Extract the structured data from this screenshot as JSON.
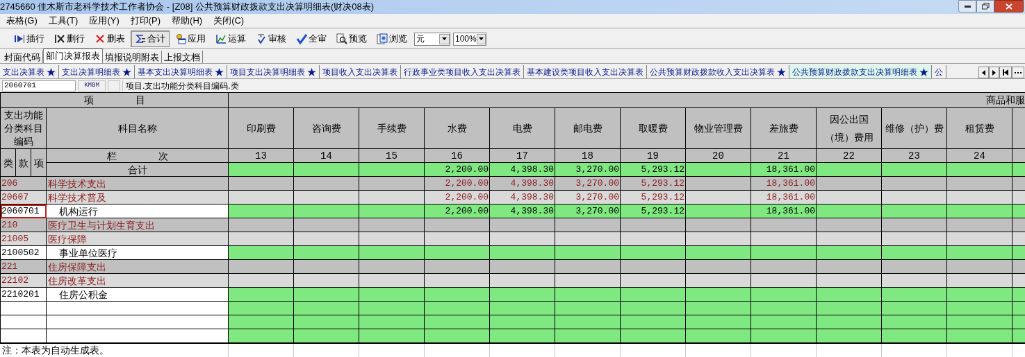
{
  "window": {
    "title": "2745660  佳木斯市老科学技术工作者协会 - [Z08] 公共预算财政拨款支出决算明细表(财决08表)"
  },
  "menu": [
    "表格(G)",
    "工具(T)",
    "应用(Y)",
    "打印(P)",
    "帮助(H)",
    "关闭(C)"
  ],
  "toolbar": {
    "buttons": [
      {
        "label": "插行",
        "kind": "insert",
        "pressed": false
      },
      {
        "label": "删行",
        "kind": "remove",
        "pressed": false
      },
      {
        "label": "删表",
        "kind": "delete",
        "pressed": false
      },
      {
        "label": "合计",
        "kind": "sum",
        "pressed": true
      },
      {
        "label": "应用",
        "kind": "apply",
        "pressed": false
      },
      {
        "label": "运算",
        "kind": "calc",
        "pressed": false
      },
      {
        "label": "审核",
        "kind": "audit",
        "pressed": false
      },
      {
        "label": "全审",
        "kind": "auditall",
        "pressed": false
      },
      {
        "label": "预览",
        "kind": "preview",
        "pressed": false
      },
      {
        "label": "浏览",
        "kind": "browse",
        "pressed": false
      }
    ],
    "unit": "元",
    "zoom": "100%"
  },
  "sheet_tabs": [
    {
      "label": "封面代码",
      "selected": false
    },
    {
      "label": "部门决算报表",
      "selected": true
    },
    {
      "label": "填报说明附表",
      "selected": false
    },
    {
      "label": "上报文档",
      "selected": false
    }
  ],
  "report_tabs": [
    {
      "label": "支出决算表",
      "starred": true,
      "selected": false
    },
    {
      "label": "支出决算明细表",
      "starred": true,
      "selected": false
    },
    {
      "label": "基本支出决算明细表",
      "starred": true,
      "selected": false
    },
    {
      "label": "项目支出决算明细表",
      "starred": true,
      "selected": false
    },
    {
      "label": "项目收入支出决算表",
      "starred": false,
      "selected": false
    },
    {
      "label": "行政事业类项目收入支出决算表",
      "starred": false,
      "selected": false
    },
    {
      "label": "基本建设类项目收入支出决算表",
      "starred": false,
      "selected": false
    },
    {
      "label": "公共预算财政拨款收入支出决算表",
      "starred": true,
      "selected": false
    },
    {
      "label": "公共预算财政拨款支出决算明细表",
      "starred": true,
      "selected": true
    },
    {
      "label": "公",
      "starred": false,
      "selected": false
    }
  ],
  "formula_bar": {
    "cell": "2060701",
    "field": "KMBM",
    "path": "项目.支出功能分类科目编码.类"
  },
  "table": {
    "group_header": "项目",
    "column_group": "商品和服",
    "code_header": "支出功能分类科目编码",
    "code_parts": [
      "类",
      "款",
      "项"
    ],
    "name_header": "科目名称",
    "index_label": "栏次",
    "columns": [
      {
        "name": "印刷费",
        "number": "13"
      },
      {
        "name": "咨询费",
        "number": "14"
      },
      {
        "name": "手续费",
        "number": "15"
      },
      {
        "name": "水费",
        "number": "16"
      },
      {
        "name": "电费",
        "number": "17"
      },
      {
        "name": "邮电费",
        "number": "18"
      },
      {
        "name": "取暖费",
        "number": "19"
      },
      {
        "name": "物业管理费",
        "number": "20"
      },
      {
        "name": "差旅费",
        "number": "21"
      },
      {
        "name": "因公出国（境）费用",
        "number": "22"
      },
      {
        "name": "维修（护）费",
        "number": "23"
      },
      {
        "name": "租赁费",
        "number": "24"
      }
    ],
    "total": {
      "label": "合计",
      "amounts": {
        "水费": "2,200.00",
        "电费": "4,398.30",
        "邮电费": "3,270.00",
        "取暖费": "5,293.12",
        "差旅费": "18,361.00"
      }
    },
    "rows": [
      {
        "kind": "category",
        "code": "206",
        "name": "科学技术支出",
        "active": false,
        "amounts": {
          "水费": "2,200.00",
          "电费": "4,398.30",
          "邮电费": "3,270.00",
          "取暖费": "5,293.12",
          "差旅费": "18,361.00"
        }
      },
      {
        "kind": "subcategory",
        "code": "20607",
        "name": "科学技术普及",
        "active": false,
        "amounts": {
          "水费": "2,200.00",
          "电费": "4,398.30",
          "邮电费": "3,270.00",
          "取暖费": "5,293.12",
          "差旅费": "18,361.00"
        }
      },
      {
        "kind": "item",
        "code": "2060701",
        "name": "机构运行",
        "active": true,
        "amounts": {
          "水费": "2,200.00",
          "电费": "4,398.30",
          "邮电费": "3,270.00",
          "取暖费": "5,293.12",
          "差旅费": "18,361.00"
        }
      },
      {
        "kind": "category",
        "code": "210",
        "name": "医疗卫生与计划生育支出",
        "active": false
      },
      {
        "kind": "subcategory",
        "code": "21005",
        "name": "医疗保障",
        "active": false
      },
      {
        "kind": "item",
        "code": "2100502",
        "name": "事业单位医疗",
        "active": false
      },
      {
        "kind": "category",
        "code": "221",
        "name": "住房保障支出",
        "active": false
      },
      {
        "kind": "subcategory",
        "code": "22102",
        "name": "住房改革支出",
        "active": false
      },
      {
        "kind": "item",
        "code": "2210201",
        "name": "住房公积金",
        "active": false
      },
      {
        "kind": "blank"
      },
      {
        "kind": "blank"
      },
      {
        "kind": "blank"
      }
    ]
  },
  "note": "注：本表为自动生成表。"
}
